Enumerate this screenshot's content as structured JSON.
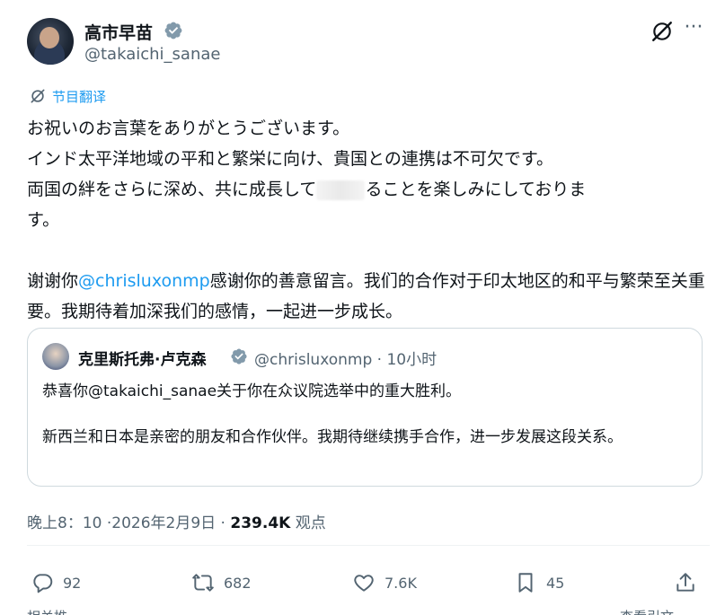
{
  "author": {
    "display_name": "高市早苗",
    "handle": "@takaichi_sanae"
  },
  "translate": {
    "label": "节目翻译"
  },
  "post": {
    "original_lines": [
      "お祝いのお言葉をありがとうございます。",
      "インド太平洋地域の平和と繁栄に向け、貴国との連携は不可欠です。",
      "両国の絆をさらに深め、共に成長して",
      "ることを楽しみにしておりま",
      "す。"
    ],
    "translation_prefix": "谢谢你",
    "translation_mention": "@chrisluxonmp",
    "translation_rest": "感谢你的善意留言。我们的合作对于印太地区的和平与繁荣至关重要。我期待着加深我们的感情，一起进一步成长。"
  },
  "quote": {
    "display_name": "克里斯托弗·卢克森",
    "handle_time": "@chrisluxonmp · 10小时",
    "line1": "恭喜你@takaichi_sanae关于你在众议院选举中的重大胜利。",
    "line2": "新西兰和日本是亲密的朋友和合作伙伴。我期待继续携手合作，进一步发展这段关系。"
  },
  "meta": {
    "timestamp": "晚上8：10 ·2026年2月9日 · ",
    "views_count": "239.4K",
    "views_label": " 观点"
  },
  "actions": {
    "replies": "92",
    "reposts": "682",
    "likes": "7.6K",
    "bookmarks": "45"
  },
  "cut_off": {
    "left": "相关推",
    "right": "查看引文"
  },
  "colors": {
    "accent": "#1d9bf0",
    "secondary_text": "#536471",
    "border": "#cfd9de"
  },
  "icons": {
    "verified": "verified-badge-icon",
    "grok": "grok-icon",
    "more": "more-icon",
    "translate": "translate-icon",
    "reply": "reply-icon",
    "repost": "repost-icon",
    "like": "heart-icon",
    "bookmark": "bookmark-icon",
    "share": "share-icon"
  }
}
